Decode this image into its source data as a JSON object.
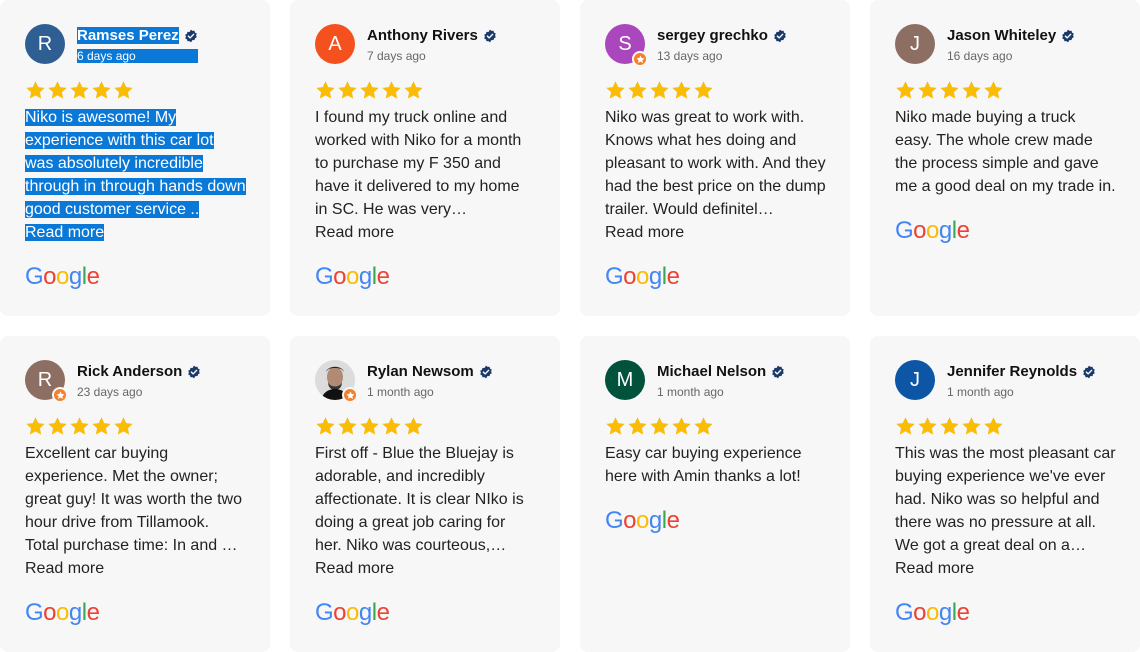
{
  "colors": {
    "star": "#fbbc04",
    "verified": "#1a3a6b",
    "highlight": "#0a78d7",
    "card_bg": "#f7f7f7"
  },
  "brand": {
    "google": "Google"
  },
  "reviews": [
    {
      "name": "Ramses Perez",
      "date": "6 days ago",
      "initial": "R",
      "avatar_color": "#2f5e93",
      "rating": 5,
      "text": "Niko is awesome! My experience with this car lot was absolutely incredible through in through hands down good customer service ..",
      "more": "Read more",
      "selected": true
    },
    {
      "name": "Anthony Rivers",
      "date": "7 days ago",
      "initial": "A",
      "avatar_color": "#f4511e",
      "rating": 5,
      "text": "I found my truck online and worked with Niko for a month to purchase my F 350 and have it delivered to my home in SC. He was very…",
      "more": "Read more"
    },
    {
      "name": "sergey grechko",
      "date": "13 days ago",
      "initial": "S",
      "avatar_color": "#ab47bc",
      "rating": 5,
      "badge": true,
      "text": "Niko was great to work with. Knows what hes doing and pleasant to work with. And they had the best price on the dump trailer. Would definitel…",
      "more": "Read more"
    },
    {
      "name": "Jason Whiteley",
      "date": "16 days ago",
      "initial": "J",
      "avatar_color": "#8d6e63",
      "rating": 5,
      "text": "Niko made buying a truck easy. The whole crew made the process simple and gave me a good deal on my trade in.",
      "more": ""
    },
    {
      "name": "Rick Anderson",
      "date": "23 days ago",
      "initial": "R",
      "avatar_color": "#8d6e63",
      "rating": 5,
      "badge": true,
      "text": "Excellent car buying experience. Met the owner; great guy! It was worth the two hour drive from Tillamook. Total purchase time: In and …",
      "more": "Read more"
    },
    {
      "name": "Rylan Newsom",
      "date": "1 month ago",
      "initial": "",
      "avatar_color": "#d9d9d9",
      "rating": 5,
      "badge": true,
      "photo": true,
      "text": "First off - Blue the Bluejay is adorable, and incredibly affectionate. It is clear NIko is doing a great job caring for her. Niko was courteous,…",
      "more": "Read more"
    },
    {
      "name": "Michael Nelson",
      "date": "1 month ago",
      "initial": "M",
      "avatar_color": "#00523a",
      "rating": 5,
      "text": "Easy car buying experience here with Amin thanks a lot!",
      "more": ""
    },
    {
      "name": "Jennifer Reynolds",
      "date": "1 month ago",
      "initial": "J",
      "avatar_color": "#0d56a6",
      "rating": 5,
      "text": "This was the most pleasant car buying experience we've ever had. Niko was so helpful and there was no pressure at all. We got a great deal on a…",
      "more": "Read more"
    }
  ]
}
